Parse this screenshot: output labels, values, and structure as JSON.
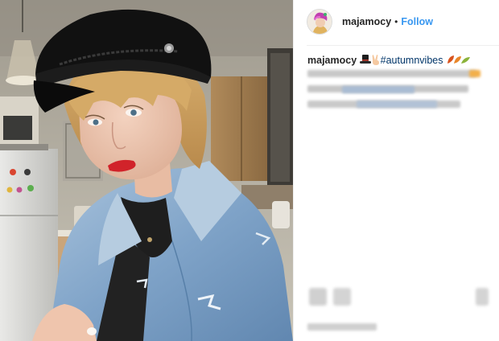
{
  "post": {
    "username": "majamocy",
    "separator": "•",
    "follow_label": "Follow"
  },
  "caption": {
    "username": "majamocy",
    "hashtag": "#autumnvibes"
  },
  "icons": {
    "hat": "top-hat-emoji-icon",
    "hand": "victory-hand-emoji-icon",
    "leaves": "autumn-leaves-emoji-icon"
  },
  "colors": {
    "follow": "#3897f0",
    "hashtag": "#003569",
    "text": "#262626",
    "divider": "#efefef"
  }
}
